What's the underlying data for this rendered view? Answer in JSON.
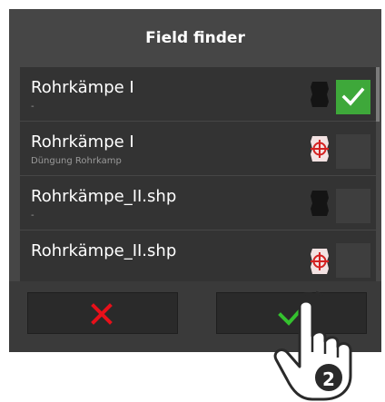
{
  "dialog": {
    "title": "Field finder",
    "rows": [
      {
        "title": "Rohrkämpe I",
        "subtitle": "-",
        "icon": "field-boundary-icon",
        "checked": true
      },
      {
        "title": "Rohrkämpe I",
        "subtitle": "Düngung Rohrkamp",
        "icon": "application-map-icon",
        "checked": false
      },
      {
        "title": "Rohrkämpe_II.shp",
        "subtitle": "-",
        "icon": "field-boundary-icon",
        "checked": false
      },
      {
        "title": "Rohrkämpe_II.shp",
        "subtitle": "",
        "icon": "application-map-icon",
        "checked": false
      }
    ],
    "cancel_icon": "cancel-x-icon",
    "confirm_icon": "confirm-check-icon"
  },
  "overlay": {
    "hand_icon": "tap-hand-icon",
    "step_badge": "2"
  },
  "colors": {
    "dialog_bg": "#464646",
    "row_bg": "#333333",
    "checked_green": "#3ea83a",
    "cancel_red": "#e8101a",
    "confirm_green": "#34c22e"
  }
}
